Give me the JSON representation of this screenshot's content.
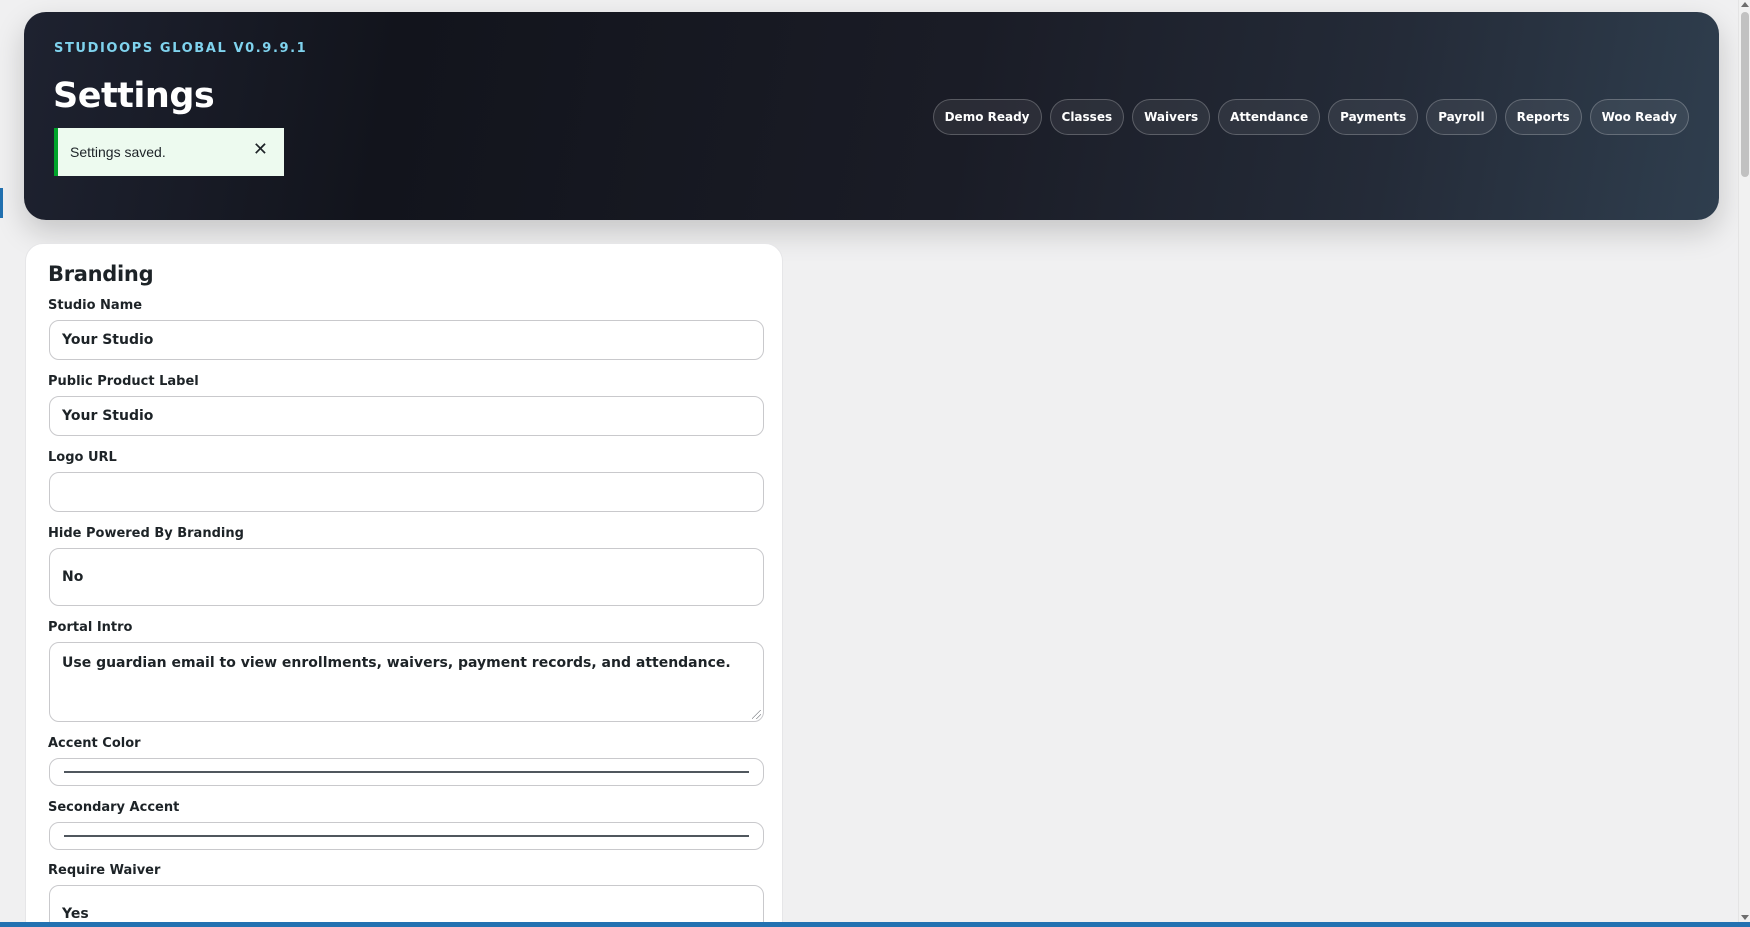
{
  "header": {
    "version": "STUDIOOPS GLOBAL V0.9.9.1",
    "title": "Settings",
    "notice": {
      "text": "Settings saved.",
      "dismiss": "✕"
    },
    "nav": [
      "Demo Ready",
      "Classes",
      "Waivers",
      "Attendance",
      "Payments",
      "Payroll",
      "Reports",
      "Woo Ready"
    ]
  },
  "branding": {
    "heading": "Branding",
    "studio_name": {
      "label": "Studio Name",
      "value": "Your Studio"
    },
    "product_label": {
      "label": "Public Product Label",
      "value": "Your Studio"
    },
    "logo_url": {
      "label": "Logo URL",
      "value": ""
    },
    "hide_powered": {
      "label": "Hide Powered By Branding",
      "value": "No"
    },
    "portal_intro": {
      "label": "Portal Intro",
      "value": "Use guardian email to view enrollments, waivers, payment records, and attendance."
    },
    "accent_color": {
      "label": "Accent Color"
    },
    "secondary_accent": {
      "label": "Secondary Accent"
    },
    "require_waiver": {
      "label": "Require Waiver",
      "value": "Yes"
    }
  },
  "colors": {
    "accent": "#7fd3ee",
    "notice_border": "#00a32a",
    "admin_blue": "#2271b1"
  }
}
